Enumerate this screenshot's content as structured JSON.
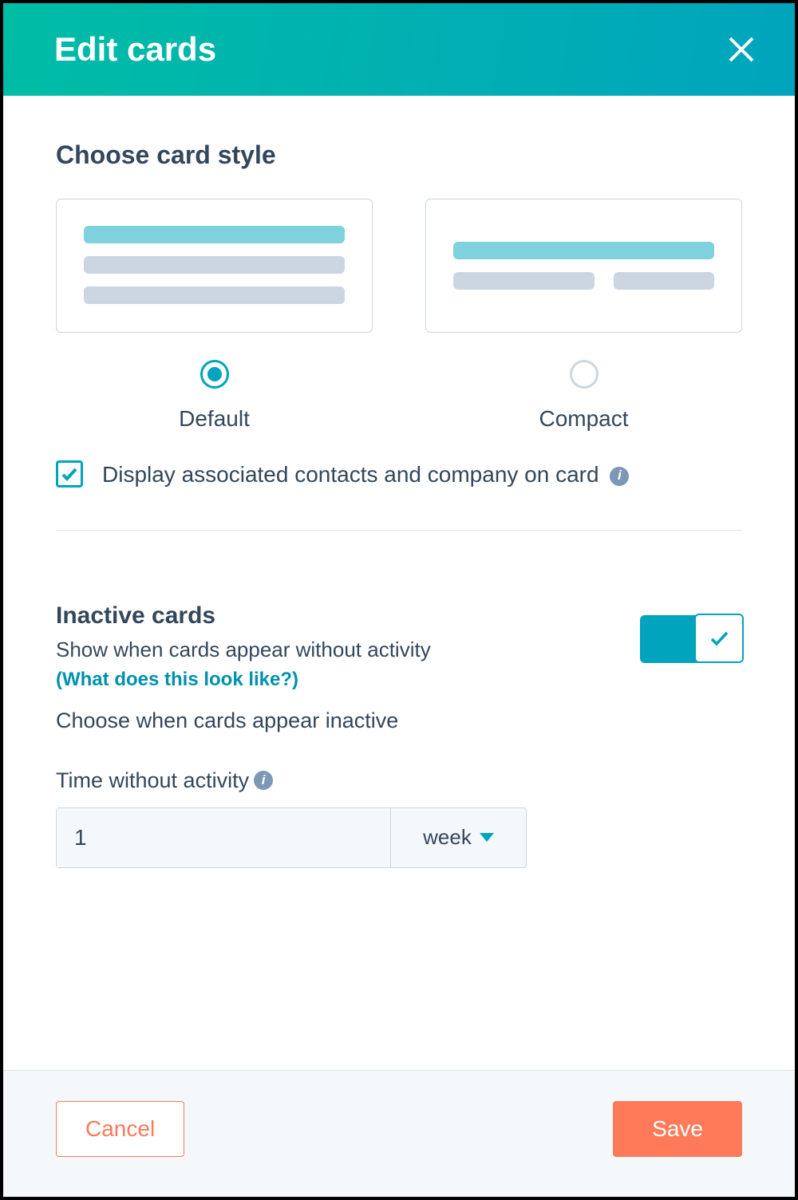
{
  "header": {
    "title": "Edit cards"
  },
  "cardStyle": {
    "sectionTitle": "Choose card style",
    "options": {
      "default": {
        "label": "Default",
        "selected": true
      },
      "compact": {
        "label": "Compact",
        "selected": false
      }
    },
    "checkbox": {
      "checked": true,
      "label": "Display associated contacts and company on card"
    }
  },
  "inactive": {
    "title": "Inactive cards",
    "subtitle": "Show when cards appear without activity",
    "helpLink": "(What does this look like?)",
    "chooseWhen": "Choose when cards appear inactive",
    "twaLabel": "Time without activity",
    "toggleOn": true,
    "duration": {
      "value": "1",
      "unit": "week"
    }
  },
  "footer": {
    "cancel": "Cancel",
    "save": "Save"
  }
}
